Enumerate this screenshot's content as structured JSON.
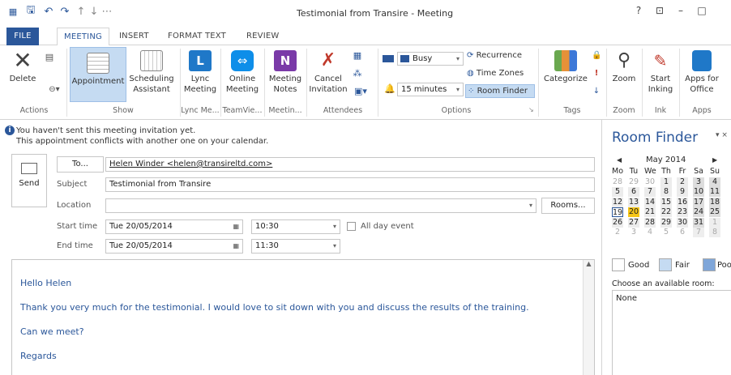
{
  "window": {
    "title": "Testimonial from Transire - Meeting",
    "help": "?",
    "restore": "⊡",
    "minimize": "–",
    "maximize": "□"
  },
  "qat": {
    "save": "🖫",
    "undo": "↶",
    "redo": "↷",
    "up": "↑",
    "down": "↓",
    "more": "⋯"
  },
  "tabs": [
    {
      "label": "FILE"
    },
    {
      "label": "MEETING"
    },
    {
      "label": "INSERT"
    },
    {
      "label": "FORMAT TEXT"
    },
    {
      "label": "REVIEW"
    }
  ],
  "ribbon": {
    "delete": "Delete",
    "appointment": "Appointment",
    "scheduling1": "Scheduling",
    "scheduling2": "Assistant",
    "lync1": "Lync",
    "lync2": "Meeting",
    "online1": "Online",
    "online2": "Meeting",
    "notes1": "Meeting",
    "notes2": "Notes",
    "cancel1": "Cancel",
    "cancel2": "Invitation",
    "busy": "Busy",
    "reminder": "15 minutes",
    "recurrence": "Recurrence",
    "timezones": "Time Zones",
    "roomfinder": "Room Finder",
    "categorize": "Categorize",
    "zoom": "Zoom",
    "inking1": "Start",
    "inking2": "Inking",
    "apps1": "Apps for",
    "apps2": "Office",
    "groups": {
      "actions": "Actions",
      "show": "Show",
      "lync": "Lync Me...",
      "teamviewer": "TeamVie...",
      "meeting": "Meetin...",
      "attendees": "Attendees",
      "options": "Options",
      "tags": "Tags",
      "zoom": "Zoom",
      "ink": "Ink",
      "apps": "Apps"
    }
  },
  "info": {
    "line1": "You haven't sent this meeting invitation yet.",
    "line2": "This appointment conflicts with another one on your calendar."
  },
  "form": {
    "send": "Send",
    "to_btn": "To...",
    "to": "Helen Winder <helen@transireltd.com>",
    "subject_lbl": "Subject",
    "subject": "Testimonial from Transire",
    "location_lbl": "Location",
    "location": "",
    "rooms": "Rooms...",
    "start_lbl": "Start time",
    "start_date": "Tue 20/05/2014",
    "start_time": "10:30",
    "allday": "All day event",
    "end_lbl": "End time",
    "end_date": "Tue 20/05/2014",
    "end_time": "11:30"
  },
  "body": {
    "l1": "Hello Helen",
    "l2": "Thank you very much for the testimonial. I would love to sit down with you and discuss the results of the training.",
    "l3": "Can we meet?",
    "l4": "Regards"
  },
  "roomfinder": {
    "title": "Room Finder",
    "month": "May 2014",
    "prev": "◀",
    "next": "▶",
    "days": [
      "Mo",
      "Tu",
      "We",
      "Th",
      "Fr",
      "Sa",
      "Su"
    ],
    "weeks": [
      [
        "28",
        "29",
        "30",
        "1",
        "2",
        "3",
        "4"
      ],
      [
        "5",
        "6",
        "7",
        "8",
        "9",
        "10",
        "11"
      ],
      [
        "12",
        "13",
        "14",
        "15",
        "16",
        "17",
        "18"
      ],
      [
        "19",
        "20",
        "21",
        "22",
        "23",
        "24",
        "25"
      ],
      [
        "26",
        "27",
        "28",
        "29",
        "30",
        "31",
        "1"
      ],
      [
        "2",
        "3",
        "4",
        "5",
        "6",
        "7",
        "8"
      ]
    ],
    "good": "Good",
    "fair": "Fair",
    "poor": "Poo",
    "choose": "Choose an available room:",
    "none": "None"
  },
  "colors": {
    "accent": "#2b579a",
    "selected": "#c5dbf2"
  }
}
